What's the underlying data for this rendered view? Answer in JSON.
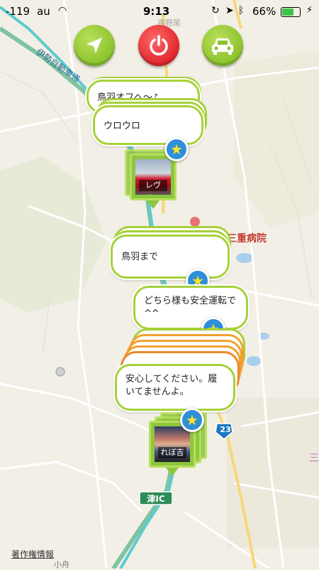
{
  "status_bar": {
    "signal": "-119",
    "carrier": "au",
    "time": "9:13",
    "battery": "66%"
  },
  "toolbar": {
    "navigate_icon": "navigate-arrow-icon",
    "power_icon": "power-icon",
    "car_icon": "car-icon",
    "colors": {
      "green": "#8bc22c",
      "red": "#e0262c"
    }
  },
  "bubbles": [
    {
      "text": "鳥羽オフへ〜♪"
    },
    {
      "text": "ウロウロ"
    },
    {
      "text": "鳥羽まで"
    },
    {
      "text": "どちら様も安全運転で^^"
    },
    {
      "text": "安心してください。履いてませんよ。"
    }
  ],
  "pins": [
    {
      "caption": "レヴォ..."
    },
    {
      "caption": "れぼ吉"
    }
  ],
  "map_labels": {
    "hospital": "三重病院",
    "route_number": "23",
    "ic_label": "津IC",
    "attribution": "著作権情報",
    "top_place": "高野尾",
    "bottom_place": "小舟",
    "right_char": "三"
  },
  "colors": {
    "route_line": "#5ccbd0",
    "bubble_border": "#a6d13a",
    "star_blue": "#2f8fd8"
  }
}
